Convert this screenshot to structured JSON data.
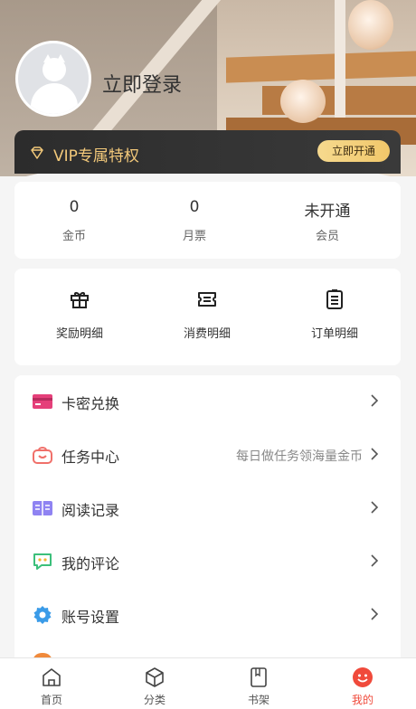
{
  "profile": {
    "login_text": "立即登录"
  },
  "vip": {
    "title": "VIP专属特权",
    "button": "立即开通",
    "accent": "#f3c97a"
  },
  "stats": [
    {
      "value": "0",
      "label": "金币"
    },
    {
      "value": "0",
      "label": "月票"
    },
    {
      "value": "未开通",
      "label": "会员"
    }
  ],
  "shortcuts": [
    {
      "label": "奖励明细",
      "icon": "gift-icon"
    },
    {
      "label": "消费明细",
      "icon": "ticket-icon"
    },
    {
      "label": "订单明细",
      "icon": "order-list-icon"
    }
  ],
  "menu": [
    {
      "label": "卡密兑换",
      "hint": "",
      "icon": "card-icon",
      "color": "#e5407a"
    },
    {
      "label": "任务中心",
      "hint": "每日做任务领海量金币",
      "icon": "task-bag-icon",
      "color": "#f0706a"
    },
    {
      "label": "阅读记录",
      "hint": "",
      "icon": "book-icon",
      "color": "#8f83f2"
    },
    {
      "label": "我的评论",
      "hint": "",
      "icon": "comment-icon",
      "color": "#3cbf7a"
    },
    {
      "label": "账号设置",
      "hint": "",
      "icon": "settings-icon",
      "color": "#3a9be8"
    }
  ],
  "tabs": [
    {
      "label": "首页",
      "icon": "home-icon"
    },
    {
      "label": "分类",
      "icon": "category-icon"
    },
    {
      "label": "书架",
      "icon": "bookshelf-icon"
    },
    {
      "label": "我的",
      "icon": "profile-smile-icon"
    }
  ],
  "colors": {
    "active_tab": "#f04a3b",
    "background": "#f5f5f5"
  }
}
